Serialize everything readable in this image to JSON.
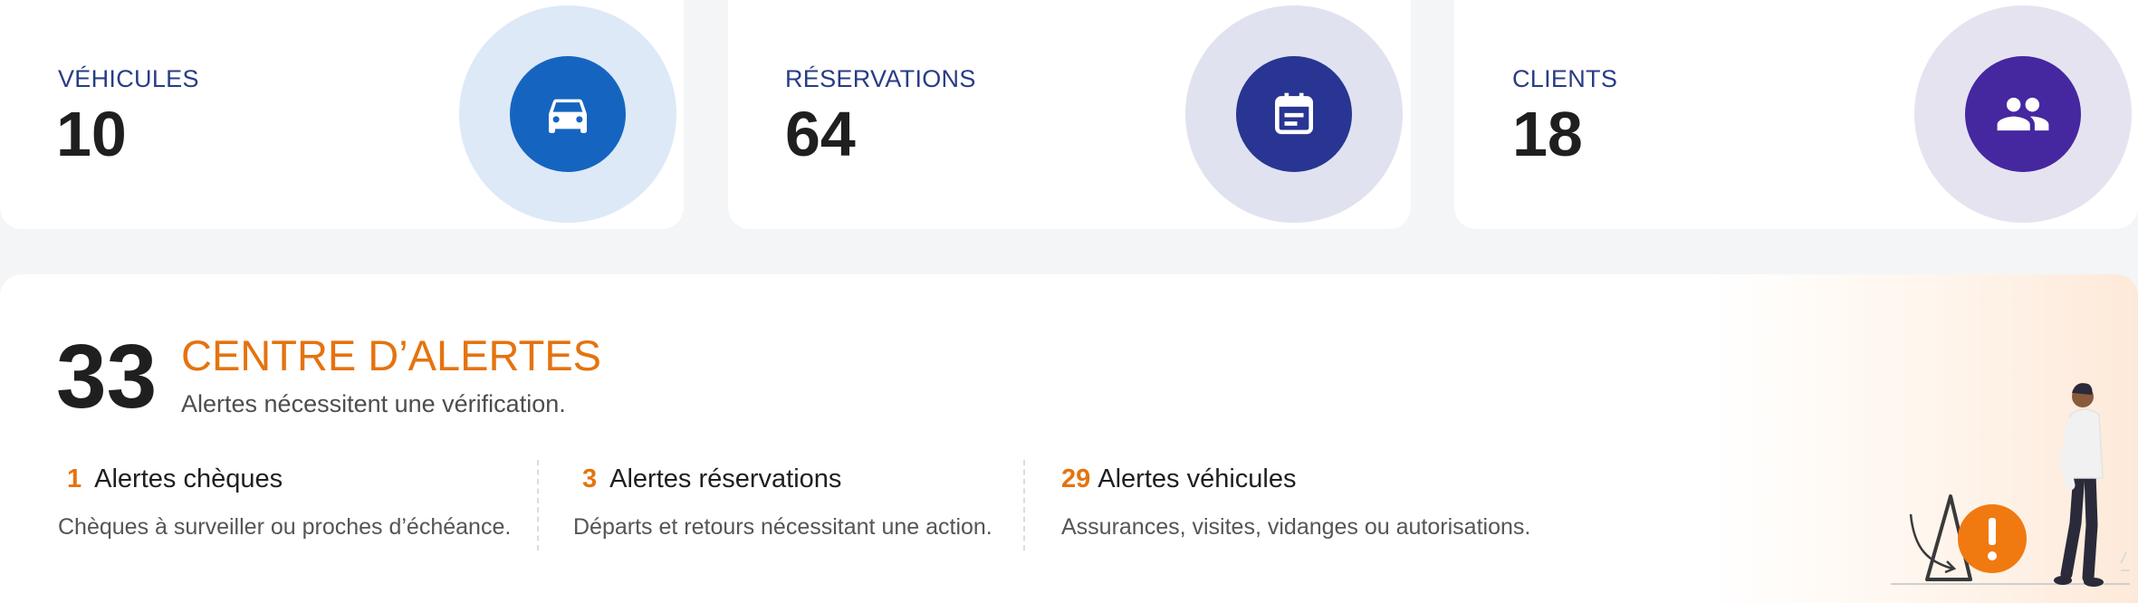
{
  "stats": [
    {
      "label": "VÉHICULES",
      "value": "10",
      "icon": "car-icon",
      "color": "#1565c0",
      "halo": "#dde9f7"
    },
    {
      "label": "RÉSERVATIONS",
      "value": "64",
      "icon": "calendar-icon",
      "color": "#283593",
      "halo": "#e0e2ef"
    },
    {
      "label": "CLIENTS",
      "value": "18",
      "icon": "people-icon",
      "color": "#4527a0",
      "halo": "#e6e3f1"
    }
  ],
  "alerts": {
    "count": "33",
    "title": "CENTRE D’ALERTES",
    "subtitle": "Alertes nécessitent une vérification.",
    "accent_color": "#e5730f",
    "categories": [
      {
        "count": "1",
        "label": "Alertes chèques",
        "description": "Chèques à surveiller ou proches d’échéance."
      },
      {
        "count": "3",
        "label": "Alertes réservations",
        "description": "Départs et retours nécessitant une action."
      },
      {
        "count": "29",
        "label": "Alertes véhicules",
        "description": "Assurances, visites, vidanges ou autorisations."
      }
    ],
    "illustration": "person-with-warning-sign-illustration"
  }
}
